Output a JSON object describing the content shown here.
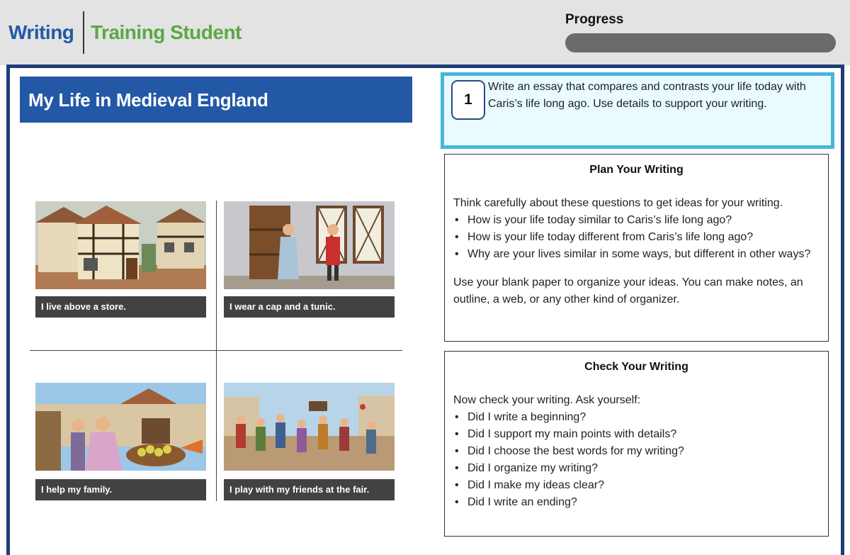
{
  "header": {
    "app_name": "Writing",
    "user_name": "Training Student",
    "progress_label": "Progress",
    "progress_value": 0
  },
  "article": {
    "title": "My Life in Medieval England",
    "panels": [
      {
        "caption": "I live above a store."
      },
      {
        "caption": "I wear a cap and a tunic."
      },
      {
        "caption": "I help my family."
      },
      {
        "caption": "I play with my friends at the fair."
      }
    ]
  },
  "prompt": {
    "number": "1",
    "text": "Write an essay that compares and contrasts your life today with Caris’s life long ago. Use details to support your writing."
  },
  "plan": {
    "heading": "Plan Your Writing",
    "intro": "Think carefully about these questions to get ideas for your writing.",
    "bullets": [
      "How is your life today similar to Caris’s life long ago?",
      "How is your life today different from Caris’s life long ago?",
      "Why are your lives similar in some ways, but different in other ways?"
    ],
    "outro": "Use your blank paper to organize your ideas. You can make notes, an outline, a web, or any other kind of organizer."
  },
  "check": {
    "heading": "Check Your Writing",
    "intro": "Now check your writing. Ask yourself:",
    "bullets": [
      "Did I write a beginning?",
      "Did I support my main points with details?",
      "Did I choose the best words for my writing?",
      "Did I organize my writing?",
      "Did I make my ideas clear?",
      "Did I write an ending?"
    ]
  },
  "colors": {
    "brand_blue": "#2458a8",
    "brand_green": "#5aa845",
    "frame_navy": "#1f3e78",
    "prompt_border": "#46b6dc",
    "caption_bg": "#424242"
  }
}
